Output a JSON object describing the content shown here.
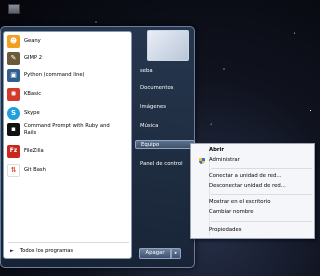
{
  "programs": [
    {
      "label": "Geany",
      "icon": "geany-icon",
      "color": "#f0a020",
      "glyph": "☻"
    },
    {
      "label": "GIMP 2",
      "icon": "gimp-icon",
      "color": "#6b5a3a",
      "glyph": "✎"
    },
    {
      "label": "Python (command line)",
      "icon": "python-icon",
      "color": "#2d5f91",
      "glyph": "▣"
    },
    {
      "label": "KBasic",
      "icon": "kbasic-icon",
      "color": "#d23a2a",
      "glyph": "✺"
    },
    {
      "label": "Skype",
      "icon": "skype-icon",
      "color": "#1d9fe0",
      "glyph": "S"
    },
    {
      "label": "Command Prompt with Ruby and Rails",
      "icon": "ruby-prompt-icon",
      "color": "#111111",
      "glyph": "▪"
    },
    {
      "label": "FileZilla",
      "icon": "filezilla-icon",
      "color": "#c9281e",
      "glyph": "Fz"
    },
    {
      "label": "Git Bash",
      "icon": "git-bash-icon",
      "color": "#e64a2e",
      "glyph": "⇅"
    }
  ],
  "all_programs": "Todos los programas",
  "right_menu": {
    "user": "seba",
    "documents": "Documentos",
    "images": "Imágenes",
    "music": "Música",
    "computer": "Equipo",
    "control_panel": "Panel de control"
  },
  "shutdown": {
    "label": "Apagar",
    "arrow": "▸"
  },
  "context_menu": {
    "open": "Abrir",
    "manage": "Administrar",
    "map_drive": "Conectar a unidad de red...",
    "disconnect_drive": "Desconectar unidad de red...",
    "show_desktop": "Mostrar en el escritorio",
    "rename": "Cambiar nombre",
    "properties": "Propiedades"
  }
}
